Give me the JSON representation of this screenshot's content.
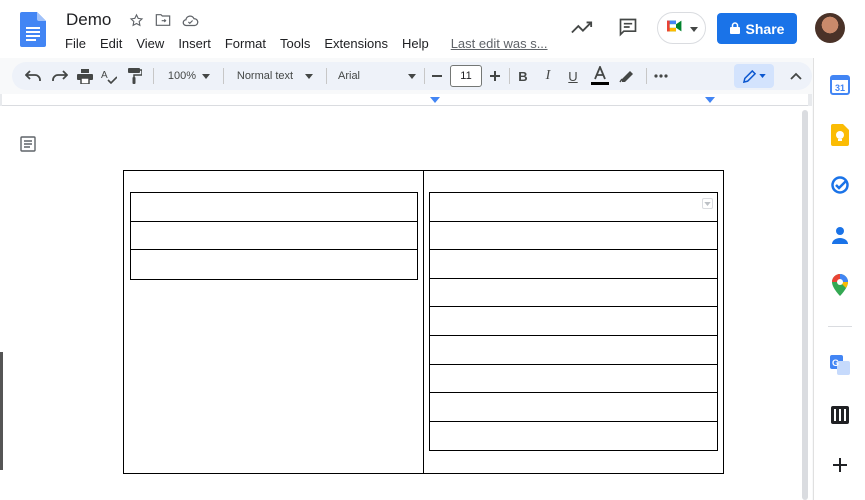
{
  "doc": {
    "title": "Demo"
  },
  "menu": {
    "items": [
      "File",
      "Edit",
      "View",
      "Insert",
      "Format",
      "Tools",
      "Extensions",
      "Help"
    ],
    "last_edit": "Last edit was s..."
  },
  "share": {
    "label": "Share"
  },
  "toolbar": {
    "zoom": "100%",
    "style": "Normal text",
    "font": "Arial",
    "size": "11"
  },
  "colors": {
    "share_bg": "#1a73e8",
    "toolbar_bg": "#eef2f9",
    "ruler_marker": "#4285f4"
  },
  "tables": {
    "outer_columns": 2,
    "left_inner_rows": 3,
    "right_inner_rows": 9
  },
  "side_panel": {
    "icons": [
      "calendar-icon",
      "keep-icon",
      "tasks-icon",
      "contacts-icon",
      "maps-icon",
      "translate-icon",
      "piano-icon",
      "add-icon"
    ]
  }
}
